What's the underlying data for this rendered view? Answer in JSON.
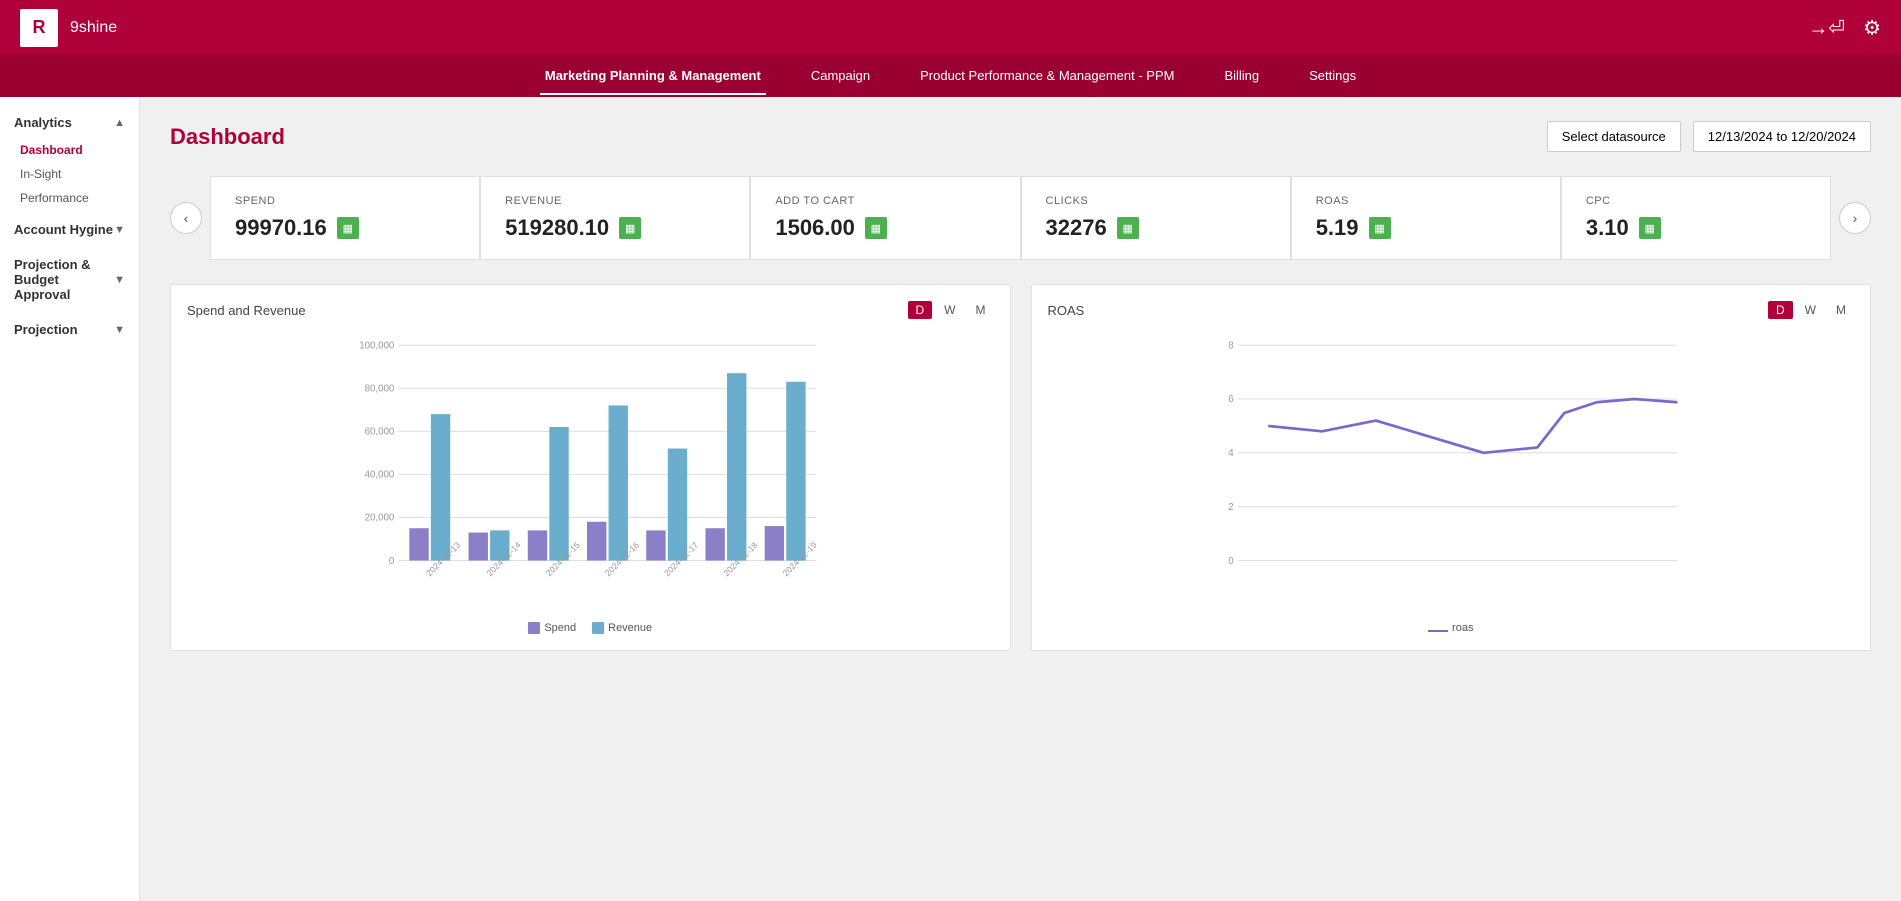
{
  "app": {
    "logo_letter": "R",
    "name": "9shine"
  },
  "nav": {
    "items": [
      {
        "label": "Marketing Planning & Management",
        "active": true
      },
      {
        "label": "Campaign",
        "active": false
      },
      {
        "label": "Product Performance & Management - PPM",
        "active": false
      },
      {
        "label": "Billing",
        "active": false
      },
      {
        "label": "Settings",
        "active": false
      }
    ]
  },
  "sidebar": {
    "sections": [
      {
        "label": "Analytics",
        "expanded": true,
        "sub_items": [
          {
            "label": "Dashboard",
            "active": true
          },
          {
            "label": "In-Sight",
            "active": false
          },
          {
            "label": "Performance",
            "active": false
          }
        ]
      },
      {
        "label": "Account Hygine",
        "expanded": false,
        "sub_items": []
      },
      {
        "label": "Projection & Budget Approval",
        "expanded": false,
        "sub_items": []
      },
      {
        "label": "Projection",
        "expanded": false,
        "sub_items": []
      }
    ]
  },
  "dashboard": {
    "title": "Dashboard",
    "select_datasource_label": "Select datasource",
    "date_range": "12/13/2024 to 12/20/2024"
  },
  "metrics": [
    {
      "label": "SPEND",
      "value": "99970.16"
    },
    {
      "label": "REVENUE",
      "value": "519280.10"
    },
    {
      "label": "ADD TO CART",
      "value": "1506.00"
    },
    {
      "label": "CLICKS",
      "value": "32276"
    },
    {
      "label": "ROAS",
      "value": "5.19"
    },
    {
      "label": "CPC",
      "value": "3.10"
    }
  ],
  "charts": {
    "spend_revenue": {
      "title": "Spend and Revenue",
      "tabs": [
        "D",
        "W",
        "M"
      ],
      "active_tab": "D",
      "bars": [
        {
          "date": "2024-12-13",
          "spend": 15000,
          "revenue": 68000
        },
        {
          "date": "2024-12-14",
          "spend": 13000,
          "revenue": 14000
        },
        {
          "date": "2024-12-15",
          "spend": 14000,
          "revenue": 62000
        },
        {
          "date": "2024-12-16",
          "spend": 18000,
          "revenue": 72000
        },
        {
          "date": "2024-12-17",
          "spend": 14000,
          "revenue": 52000
        },
        {
          "date": "2024-12-18",
          "spend": 15000,
          "revenue": 87000
        },
        {
          "date": "2024-12-19",
          "spend": 16000,
          "revenue": 83000
        }
      ],
      "max_value": 100000,
      "y_labels": [
        "100,000",
        "80,000",
        "60,000",
        "40,000",
        "20,000",
        "0"
      ],
      "legend_spend": "Spend",
      "legend_revenue": "Revenue"
    },
    "roas": {
      "title": "ROAS",
      "tabs": [
        "D",
        "W",
        "M"
      ],
      "active_tab": "D",
      "y_labels": [
        "8",
        "6",
        "4",
        "2",
        "0"
      ],
      "legend_label": "roas"
    }
  }
}
